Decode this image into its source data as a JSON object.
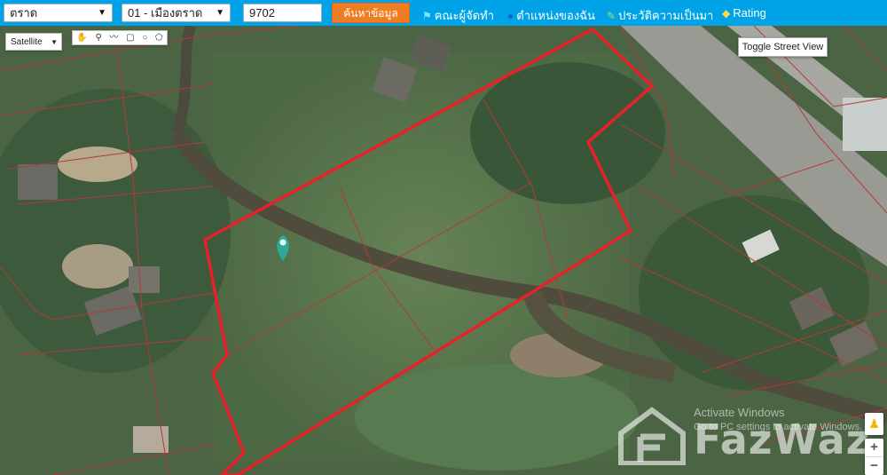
{
  "toolbar": {
    "province_value": "ตราด",
    "district_value": "01 - เมืองตราด",
    "parcel_input_value": "9702",
    "search_button_label": "ค้นหาข้อมูล",
    "links": [
      {
        "label": "คณะผู้จัดทำ",
        "icon": "team-icon"
      },
      {
        "label": "ตำแหน่งของฉัน",
        "icon": "location-person-icon"
      },
      {
        "label": "ประวัติความเป็นมา",
        "icon": "history-icon"
      },
      {
        "label": "Rating",
        "icon": "rating-icon"
      }
    ]
  },
  "map": {
    "map_type_value": "Satellite",
    "draw_tools": [
      "hand-tool",
      "marker-tool",
      "polyline-tool",
      "rectangle-tool",
      "circle-tool",
      "polygon-tool"
    ],
    "street_view_button_label": "Toggle Street View",
    "zoom_in_label": "+",
    "zoom_out_label": "−",
    "boundary_color": "#e8202a",
    "parcel_line_color": "#b23a3a",
    "marker_color": "#2fa89a"
  },
  "overlay": {
    "activate_windows_line1": "Activate Windows",
    "activate_windows_line2": "Go to PC settings to activate Windows.",
    "brand_text": "FazWaz"
  }
}
